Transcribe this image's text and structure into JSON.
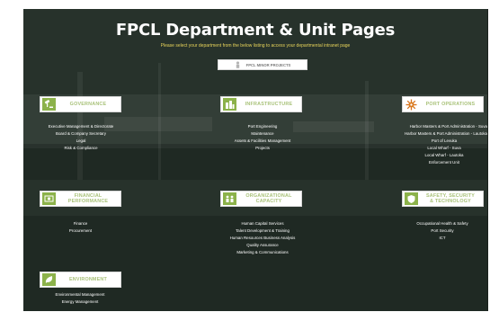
{
  "header": {
    "title": "FPCL Department & Unit Pages",
    "subtitle": "Please select your department from the below listing to access your departmental intranet page"
  },
  "minor_projects": {
    "label": "FPCL MINOR PROJECTS",
    "icon": "person-icon"
  },
  "colors": {
    "panel": "#27322b",
    "accent_green": "#8cb24a",
    "card_text": "#a9c27a",
    "subtitle": "#e7d35a"
  },
  "sections": {
    "governance": {
      "title": "GOVERNANCE",
      "icon": "gavel-icon",
      "items": [
        "Executive Management & Directorate",
        "Board & Company Secretary",
        "Legal",
        "Risk & Compliance"
      ]
    },
    "infrastructure": {
      "title": "INFRASTRUCTURE",
      "icon": "building-icon",
      "items": [
        "Port Engineering",
        "Maintenance",
        "Assets & Facilities Management",
        "Projects"
      ]
    },
    "port_operations": {
      "title": "PORT OPERATIONS",
      "icon": "helm-icon",
      "items": [
        "Harbor Masters & Port Administration - Suva",
        "Harbor Masters & Port Administration - Lautoka",
        "Port of Levuka",
        "Local Wharf - Suva",
        "Local Wharf - Lautoka",
        "Enforcement Unit"
      ]
    },
    "financial": {
      "title_line1": "FINANCIAL",
      "title_line2": "PERFORMANCE",
      "icon": "money-icon",
      "items": [
        "Finance",
        "Procurement"
      ]
    },
    "organizational": {
      "title_line1": "ORGANIZATIONAL",
      "title_line2": "CAPACITY",
      "icon": "team-icon",
      "items": [
        "Human Capital Services",
        "Talent Development & Training",
        "Human Resources Business Analysis",
        "Quality Assurance",
        "Marketing & Communications"
      ]
    },
    "safety": {
      "title_line1": "SAFETY, SECURITY",
      "title_line2": "& TECHNOLOGY",
      "icon": "shield-icon",
      "items": [
        "Occupational Health & Safety",
        "Port Security",
        "ICT"
      ]
    },
    "environment": {
      "title": "ENVIRONMENT",
      "icon": "leaf-icon",
      "items": [
        "Environmental Management",
        "Energy Management"
      ]
    }
  }
}
